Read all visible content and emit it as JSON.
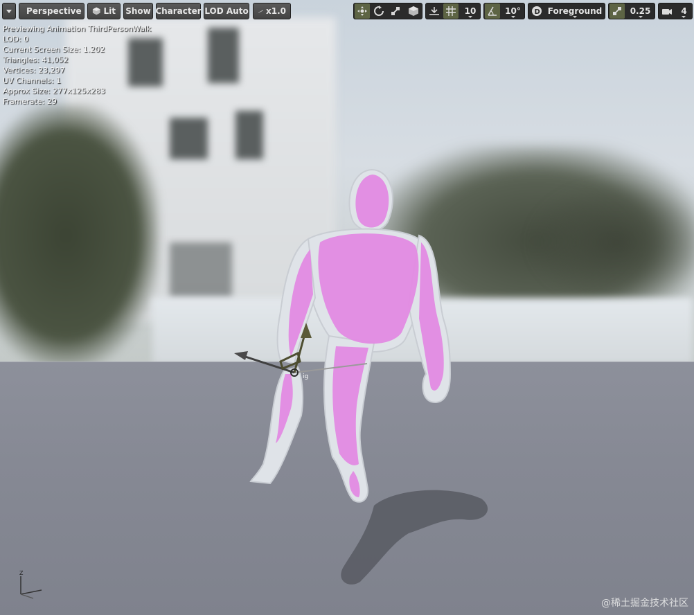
{
  "toolbar": {
    "view_mode": "Perspective",
    "lighting": "Lit",
    "show": "Show",
    "character": "Character",
    "lod": "LOD Auto",
    "speed": "x1.0",
    "grid_size": "10",
    "rotation_snap": "10°",
    "view_layer": "Foreground",
    "scale_snap": "0.25",
    "camera_speed": "4"
  },
  "stats": {
    "line1": "Previewing Animation ThirdPersonWalk",
    "line2": "LOD: 0",
    "line3": "Current Screen Size: 1.202",
    "line4": "Triangles: 41,052",
    "line5": "Vertices: 23,297",
    "line6": "UV Channels: 1",
    "line7": "Approx Size: 277x125x283",
    "line8": "Framerate: 29"
  },
  "watermark": "@稀土掘金技术社区",
  "colors": {
    "mannequin": "#e38be3",
    "toolbar_button": "#4b4b4b",
    "toolbar_active": "#5d6444"
  },
  "icons": [
    "menu-caret-icon",
    "perspective-icon",
    "lit-cube-icon",
    "speed-icon",
    "select-icon",
    "rotate-icon",
    "scale-icon",
    "world-local-icon",
    "surface-snap-icon",
    "grid-icon",
    "angle-icon",
    "scale-snap-icon",
    "camera-icon",
    "axis-indicator"
  ]
}
